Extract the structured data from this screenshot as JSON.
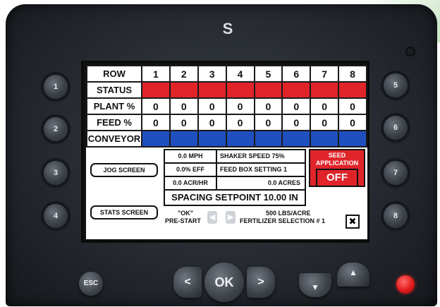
{
  "logo": "S",
  "grid": {
    "header": [
      "ROW",
      "1",
      "2",
      "3",
      "4",
      "5",
      "6",
      "7",
      "8"
    ],
    "status_label": "STATUS",
    "plant_label": "PLANT %",
    "plant_values": [
      "0",
      "0",
      "0",
      "0",
      "0",
      "0",
      "0",
      "0"
    ],
    "feed_label": "FEED %",
    "feed_values": [
      "0",
      "0",
      "0",
      "0",
      "0",
      "0",
      "0",
      "0"
    ],
    "conveyor_label": "CONVEYOR"
  },
  "panel": {
    "jog_screen": "JOG SCREEN",
    "stats_screen": "STATS SCREEN",
    "mph": "0.0 MPH",
    "eff": "0.0% EFF",
    "acr_hr": "0.0 ACR/HR",
    "shaker_speed": "SHAKER SPEED  75%",
    "feed_box": "FEED BOX SETTING 1",
    "acres": "0.0 ACRES",
    "spacing": "SPACING SETPOINT 10.00 IN",
    "seed_application_1": "SEED",
    "seed_application_2": "APPLICATION",
    "seed_state": "OFF",
    "ok_msg": "\"OK\"",
    "pre_start": "PRE-START",
    "rate": "500 LBS/ACRE",
    "fertilizer": "FERTILIZER SELECTION # 1"
  },
  "keys": {
    "left": [
      "1",
      "2",
      "3",
      "4"
    ],
    "right": [
      "5",
      "6",
      "7",
      "8"
    ],
    "esc": "ESC",
    "ok": "OK",
    "left_arrow": "<",
    "right_arrow": ">",
    "down_arrow": "▼",
    "up_arrow": "▲"
  },
  "colors": {
    "status_red": "#e0242a",
    "conveyor_blue": "#1f4fbf",
    "power_led": "#e11a1a"
  }
}
